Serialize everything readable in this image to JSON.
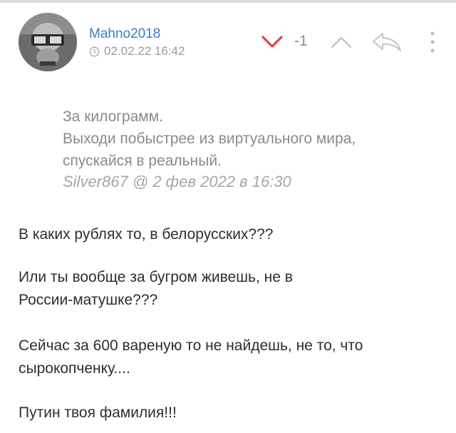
{
  "comment": {
    "author": "Mahno2018",
    "datetime": "02.02.22 16:42",
    "score": "-1",
    "quote": {
      "lines": [
        "За килограмм.",
        "Выходи побыстрее из виртуального мира,",
        "спускайся в реальный."
      ],
      "source": "Silver867 @ 2 фев 2022 в 16:30"
    },
    "paragraphs": [
      [
        "В каких рублях то, в белорусских???"
      ],
      [
        "Или ты вообще за бугром живешь, не в",
        "России-матушке???"
      ],
      [
        "Сейчас за 600 вареную то не найдешь, не то, что",
        "сырокопченку...."
      ],
      [
        "Путин твоя фамилия!!!"
      ]
    ]
  },
  "icons": {
    "avatar": "avatar",
    "clock": "clock-icon",
    "vote_down": "chevron-down-icon",
    "vote_up": "chevron-up-icon",
    "reply": "reply-arrow-icon",
    "more": "more-vertical-icon"
  },
  "colors": {
    "author": "#3a7fc4",
    "vote_down_active": "#e5414a",
    "muted": "#9a9a9a",
    "text": "#2e2e2e"
  }
}
